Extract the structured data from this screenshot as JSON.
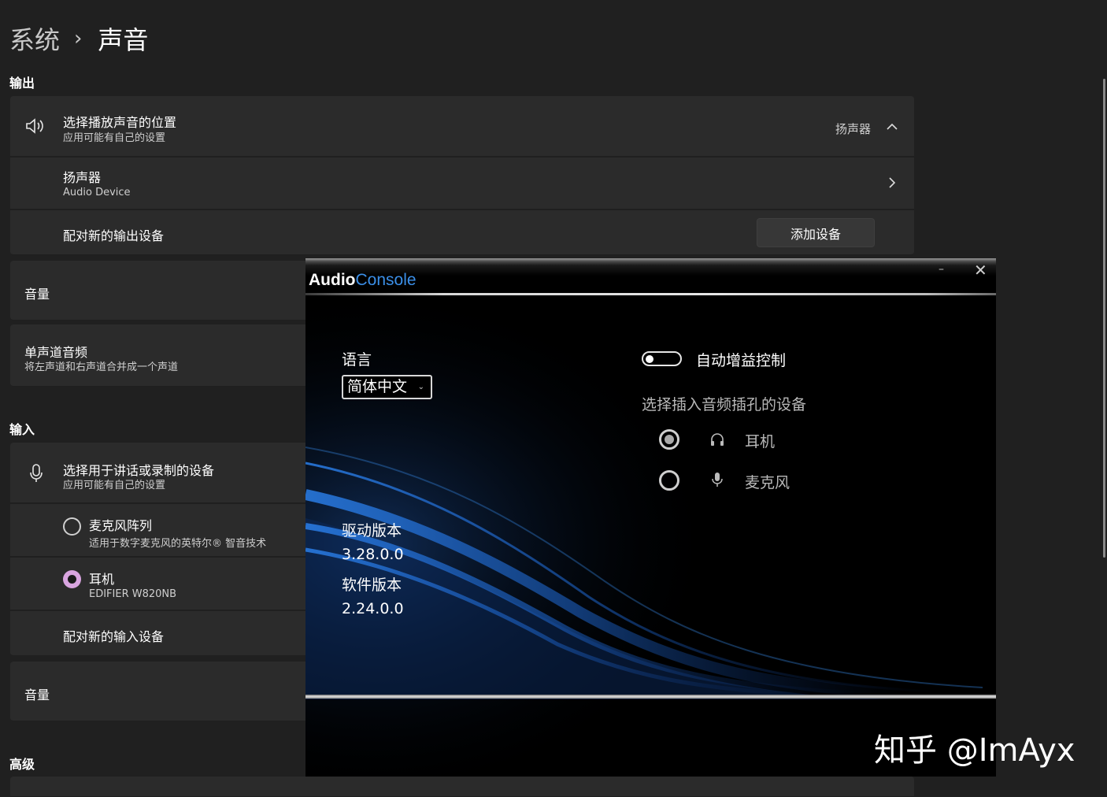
{
  "breadcrumb": {
    "parent": "系统",
    "separator": "›",
    "current": "声音"
  },
  "output": {
    "section_label": "输出",
    "choose_device": {
      "title": "选择播放声音的位置",
      "subtitle": "应用可能有自己的设置",
      "current_value": "扬声器",
      "icon": "speaker-icon"
    },
    "speaker": {
      "title": "扬声器",
      "subtitle": "Audio Device",
      "icon": "chevron-right-icon"
    },
    "pair_new": {
      "title": "配对新的输出设备",
      "button": "添加设备"
    },
    "volume": {
      "title": "音量"
    },
    "mono": {
      "title": "单声道音频",
      "subtitle": "将左声道和右声道合并成一个声道"
    }
  },
  "input": {
    "section_label": "输入",
    "choose_device": {
      "title": "选择用于讲话或录制的设备",
      "subtitle": "应用可能有自己的设置",
      "icon": "microphone-icon"
    },
    "devices": [
      {
        "title": "麦克风阵列",
        "subtitle": "适用于数字麦克风的英特尔® 智音技术",
        "selected": false
      },
      {
        "title": "耳机",
        "subtitle": "EDIFIER W820NB",
        "selected": true
      }
    ],
    "pair_new": {
      "title": "配对新的输入设备"
    },
    "volume": {
      "title": "音量"
    }
  },
  "advanced": {
    "section_label": "高级"
  },
  "audio_console": {
    "logo_part1": "Audio",
    "logo_part2": "Console",
    "minimize": "–",
    "close": "✕",
    "language_label": "语言",
    "language_value": "简体中文",
    "agc_label": "自动增益控制",
    "agc_enabled": false,
    "jack_label": "选择插入音频插孔的设备",
    "jack_options": [
      {
        "label": "耳机",
        "icon": "headphones-icon",
        "selected": true
      },
      {
        "label": "麦克风",
        "icon": "microphone-icon",
        "selected": false
      }
    ],
    "driver_version_label": "驱动版本",
    "driver_version": "3.28.0.0",
    "software_version_label": "软件版本",
    "software_version": "2.24.0.0",
    "colors": {
      "logo_accent": "#3b8fe8",
      "wave": "#1f6fd6"
    }
  },
  "watermark": "知乎 @ImAyx"
}
